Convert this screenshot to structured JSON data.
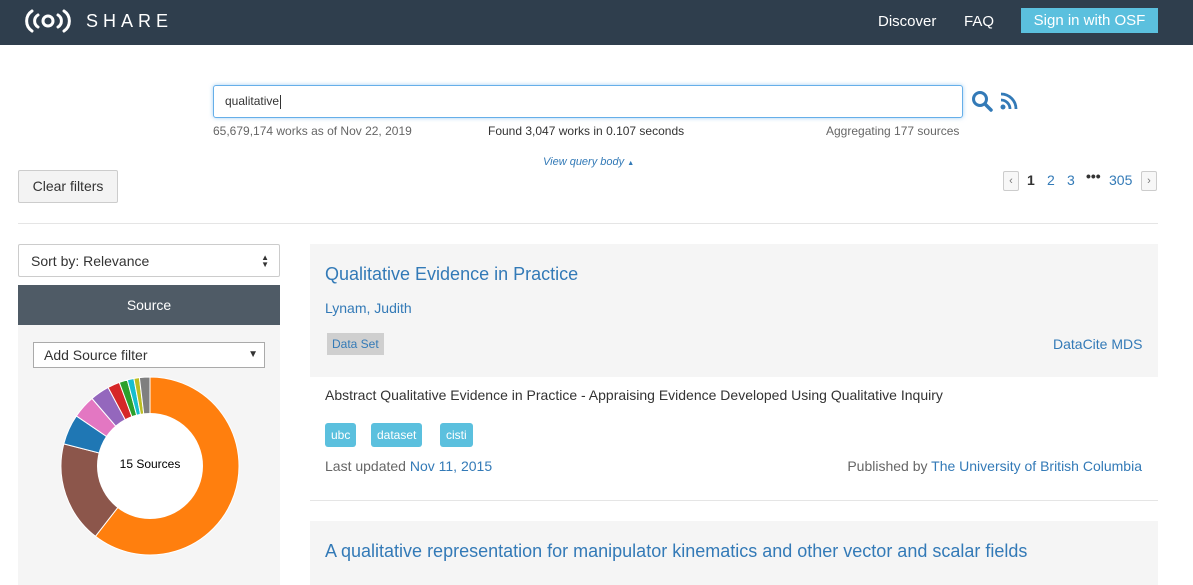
{
  "nav": {
    "brand": "SHARE",
    "links": [
      "Discover",
      "FAQ"
    ],
    "signin": "Sign in with OSF"
  },
  "search": {
    "value": "qualitative",
    "works_total": "65,679,174 works as of Nov 22, 2019",
    "found": "Found 3,047 works in 0.107 seconds",
    "aggregating": "Aggregating 177 sources",
    "view_query": "View query body"
  },
  "filters": {
    "clear": "Clear filters"
  },
  "pagination": {
    "pages": [
      "1",
      "2",
      "3",
      "305"
    ],
    "current": "1"
  },
  "sidebar": {
    "sort": "Sort by: Relevance",
    "source_heading": "Source",
    "add_filter": "Add Source filter",
    "donut_label": "15 Sources",
    "slice_colors": [
      "#ff7f0e",
      "#8c564b",
      "#1f77b4",
      "#e377c2",
      "#9467bd",
      "#d62728",
      "#2ca02c",
      "#17becf",
      "#bcbd22",
      "#7f7f7f"
    ]
  },
  "results": [
    {
      "title": "Qualitative Evidence in Practice",
      "author": "Lynam, Judith",
      "type": "Data Set",
      "source": "DataCite MDS",
      "abstract": "Abstract Qualitative Evidence in Practice - Appraising Evidence Developed Using Qualitative Inquiry",
      "tags": [
        "ubc",
        "dataset",
        "cisti"
      ],
      "updated_label": "Last updated",
      "updated_date": "Nov 11, 2015",
      "published_label": "Published by",
      "publisher": "The University of British Columbia"
    },
    {
      "title": "A qualitative representation for manipulator kinematics and other vector and scalar fields"
    }
  ]
}
